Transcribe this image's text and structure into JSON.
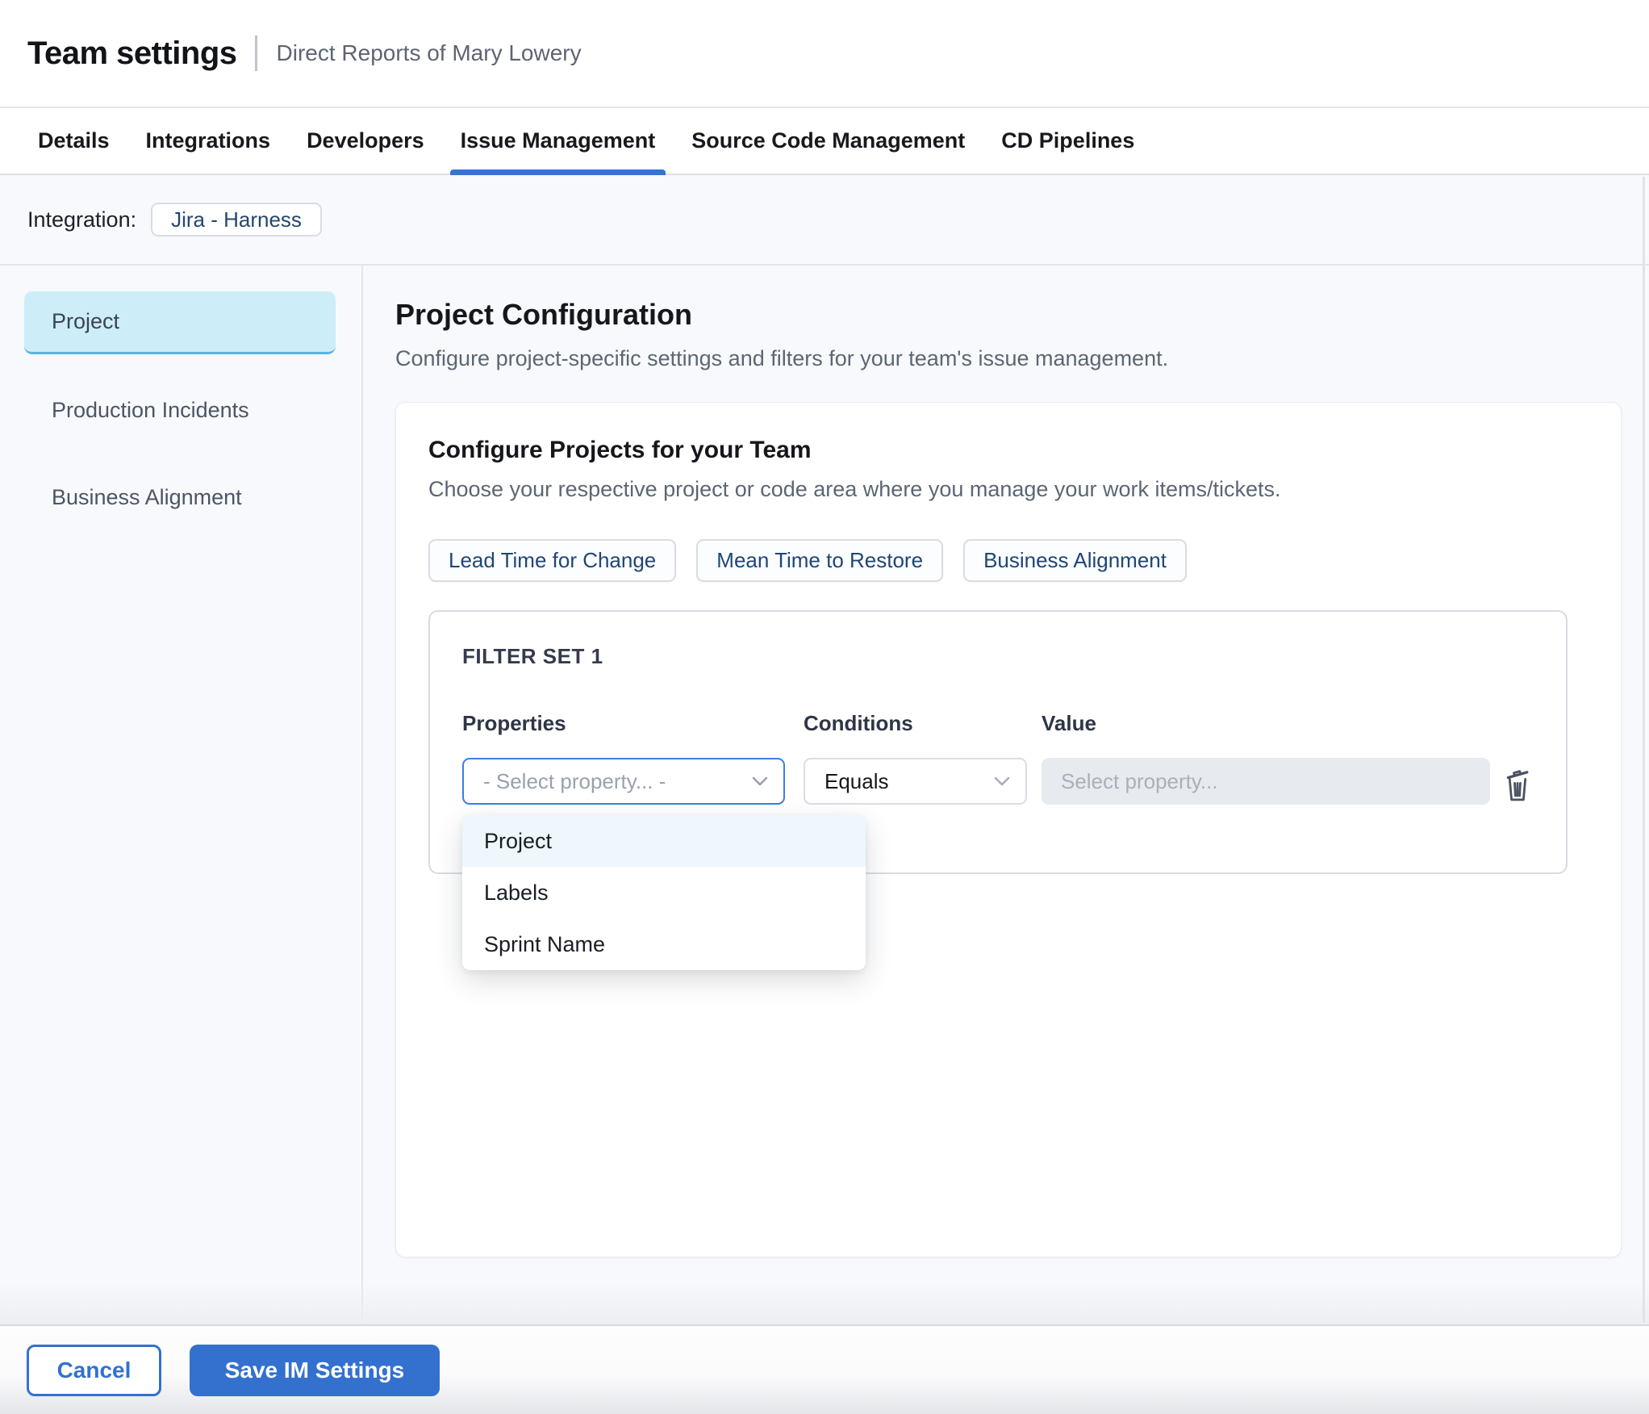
{
  "header": {
    "title": "Team settings",
    "subtitle": "Direct Reports of Mary Lowery"
  },
  "tabs": [
    {
      "label": "Details",
      "active": false
    },
    {
      "label": "Integrations",
      "active": false
    },
    {
      "label": "Developers",
      "active": false
    },
    {
      "label": "Issue Management",
      "active": true
    },
    {
      "label": "Source Code Management",
      "active": false
    },
    {
      "label": "CD Pipelines",
      "active": false
    }
  ],
  "integration": {
    "label": "Integration:",
    "chip": "Jira - Harness"
  },
  "sidebar": {
    "items": [
      {
        "label": "Project",
        "selected": true
      },
      {
        "label": "Production Incidents",
        "selected": false
      },
      {
        "label": "Business Alignment",
        "selected": false
      }
    ]
  },
  "main": {
    "title": "Project Configuration",
    "description": "Configure project-specific settings and filters for your team's issue management.",
    "card": {
      "title": "Configure Projects for your Team",
      "subtitle": "Choose your respective project or code area where you manage your work items/tickets.",
      "metric_chips": [
        {
          "label": "Lead Time for Change"
        },
        {
          "label": "Mean Time to Restore"
        },
        {
          "label": "Business Alignment"
        }
      ],
      "filter_set": {
        "title": "FILTER SET 1",
        "columns": {
          "properties": "Properties",
          "conditions": "Conditions",
          "value": "Value"
        },
        "property_select": {
          "placeholder": "- Select property... -"
        },
        "condition_select": {
          "value": "Equals"
        },
        "value_input": {
          "placeholder": "Select property..."
        },
        "dropdown": {
          "options": [
            {
              "label": "Project",
              "highlighted": true
            },
            {
              "label": "Labels",
              "highlighted": false
            },
            {
              "label": "Sprint Name",
              "highlighted": false
            }
          ]
        }
      }
    }
  },
  "footer": {
    "cancel_label": "Cancel",
    "save_label": "Save IM Settings"
  },
  "colors": {
    "accent_blue": "#3471ce",
    "tab_underline": "#3673d2",
    "focused_select_border": "#3d7de2",
    "selected_nav_bg": "#cdedf9",
    "selected_nav_border": "#57b6e2",
    "dropdown_highlight_bg": "#edf7fc",
    "disabled_input_bg": "#e7ebef",
    "content_bg": "#f8f9fc",
    "chip_text": "#24476f"
  }
}
